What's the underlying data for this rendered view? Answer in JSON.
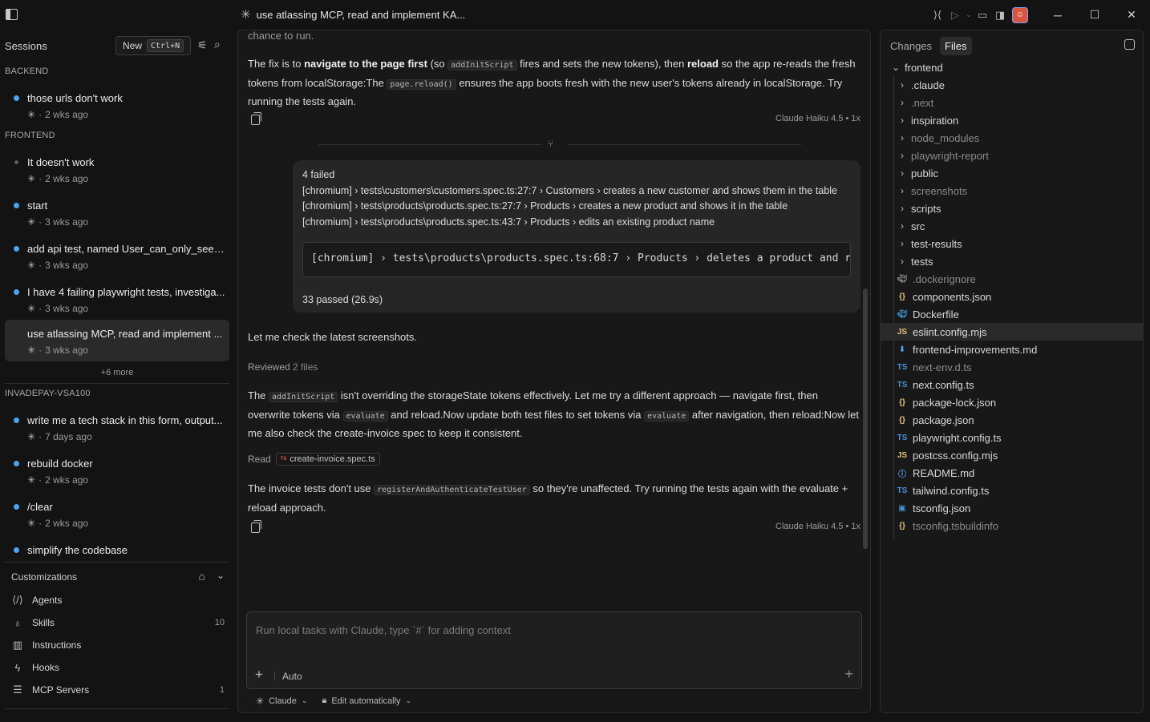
{
  "window": {
    "title": "use atlassing MCP, read and implement KA..."
  },
  "sidebar": {
    "sessions_label": "Sessions",
    "new_label": "New",
    "new_shortcut": "Ctrl+N",
    "groups": [
      {
        "name": "BACKEND"
      },
      {
        "name": "FRONTEND"
      },
      {
        "name": "INVADEPAY-VSA100"
      }
    ],
    "sessions": [
      {
        "title": "those urls don't work",
        "time": "2 wks ago"
      },
      {
        "title": "It doesn't work",
        "time": "2 wks ago"
      },
      {
        "title": "start",
        "time": "3 wks ago"
      },
      {
        "title": "add api test, named User_can_only_see_it...",
        "time": "3 wks ago"
      },
      {
        "title": "I have 4 failing playwright tests, investiga...",
        "time": "3 wks ago"
      },
      {
        "title": "use atlassing MCP, read and implement ...",
        "time": "3 wks ago"
      },
      {
        "title": "write me a tech stack in this form, output...",
        "time": "7 days ago"
      },
      {
        "title": "rebuild docker",
        "time": "2 wks ago"
      },
      {
        "title": "/clear",
        "time": "2 wks ago"
      },
      {
        "title": "simplify the codebase",
        "time": ""
      }
    ],
    "more_label": "+6 more",
    "customizations_label": "Customizations",
    "customizations": [
      {
        "label": "Agents",
        "count": ""
      },
      {
        "label": "Skills",
        "count": "10"
      },
      {
        "label": "Instructions",
        "count": ""
      },
      {
        "label": "Hooks",
        "count": ""
      },
      {
        "label": "MCP Servers",
        "count": "1"
      }
    ]
  },
  "chat": {
    "top_cut": "chance to run.",
    "fix_para": {
      "p1": "The fix is to ",
      "b1": "navigate to the page first",
      "p2": " (so ",
      "c1": "addInitScript",
      "p3": " fires and sets the new tokens), then ",
      "b2": "reload",
      "p4": " so the app re-reads the fresh tokens from localStorage:The ",
      "c2": "page.reload()",
      "p5": " ensures the app boots fresh with the new user's tokens already in localStorage. Try running the tests again."
    },
    "model_tag_1": "Claude Haiku 4.5 • 1x",
    "result": {
      "l1": "4 failed",
      "l2": "[chromium] › tests\\customers\\customers.spec.ts:27:7 › Customers › creates a new customer and shows them in the table",
      "l3": "[chromium] › tests\\products\\products.spec.ts:27:7 › Products › creates a new product and shows it in the table",
      "l4": "[chromium] › tests\\products\\products.spec.ts:43:7 › Products › edits an existing product name",
      "code": "[chromium] › tests\\products\\products.spec.ts:68:7 › Products › deletes a product and r",
      "passed": "33 passed (26.9s)"
    },
    "check_para": "Let me check the latest screenshots.",
    "reviewed_label": "Reviewed",
    "reviewed_count": "2 files",
    "storage_para": {
      "p1": "The ",
      "c1": "addInitScript",
      "p2": " isn't overriding the storageState tokens effectively. Let me try a different approach — navigate first, then overwrite tokens via ",
      "c2": "evaluate",
      "p3": " and reload.Now update both test files to set tokens via ",
      "c3": "evaluate",
      "p4": " after navigation, then reload:Now let me also check the create-invoice spec to keep it consistent."
    },
    "read_label": "Read",
    "read_file": "create-invoice.spec.ts",
    "invoice_para": {
      "p1": "The invoice tests don't use ",
      "c1": "registerAndAuthenticateTestUser",
      "p2": " so they're unaffected. Try running the tests again with the evaluate + reload approach."
    },
    "model_tag_2": "Claude Haiku 4.5 • 1x",
    "input_placeholder": "Run local tasks with Claude, type `#` for adding context",
    "auto_label": "Auto",
    "agent_label": "Claude",
    "edit_label": "Edit automatically"
  },
  "files": {
    "tabs": [
      "Changes",
      "Files"
    ],
    "root": "frontend",
    "folders": [
      ".claude",
      ".next",
      "inspiration",
      "node_modules",
      "playwright-report",
      "public",
      "screenshots",
      "scripts",
      "src",
      "test-results",
      "tests"
    ],
    "items": [
      {
        "name": ".dockerignore",
        "icon": "docker",
        "color": "#8a8a8a"
      },
      {
        "name": "components.json",
        "icon": "{}",
        "color": "#e5c07b"
      },
      {
        "name": "Dockerfile",
        "icon": "docker",
        "color": "#3b9ae1"
      },
      {
        "name": "eslint.config.mjs",
        "icon": "JS",
        "color": "#e5c07b"
      },
      {
        "name": "frontend-improvements.md",
        "icon": "md",
        "color": "#5aa0f0"
      },
      {
        "name": "next-env.d.ts",
        "icon": "TS",
        "color": "#4a90d9"
      },
      {
        "name": "next.config.ts",
        "icon": "TS",
        "color": "#4a90d9"
      },
      {
        "name": "package-lock.json",
        "icon": "{}",
        "color": "#e5c07b"
      },
      {
        "name": "package.json",
        "icon": "{}",
        "color": "#e5c07b"
      },
      {
        "name": "playwright.config.ts",
        "icon": "TS",
        "color": "#4a90d9"
      },
      {
        "name": "postcss.config.mjs",
        "icon": "JS",
        "color": "#e5c07b"
      },
      {
        "name": "README.md",
        "icon": "info",
        "color": "#5aa0f0"
      },
      {
        "name": "tailwind.config.ts",
        "icon": "TS",
        "color": "#4a90d9"
      },
      {
        "name": "tsconfig.json",
        "icon": "ts",
        "color": "#4a90d9"
      },
      {
        "name": "tsconfig.tsbuildinfo",
        "icon": "{}",
        "color": "#e5c07b"
      }
    ]
  }
}
